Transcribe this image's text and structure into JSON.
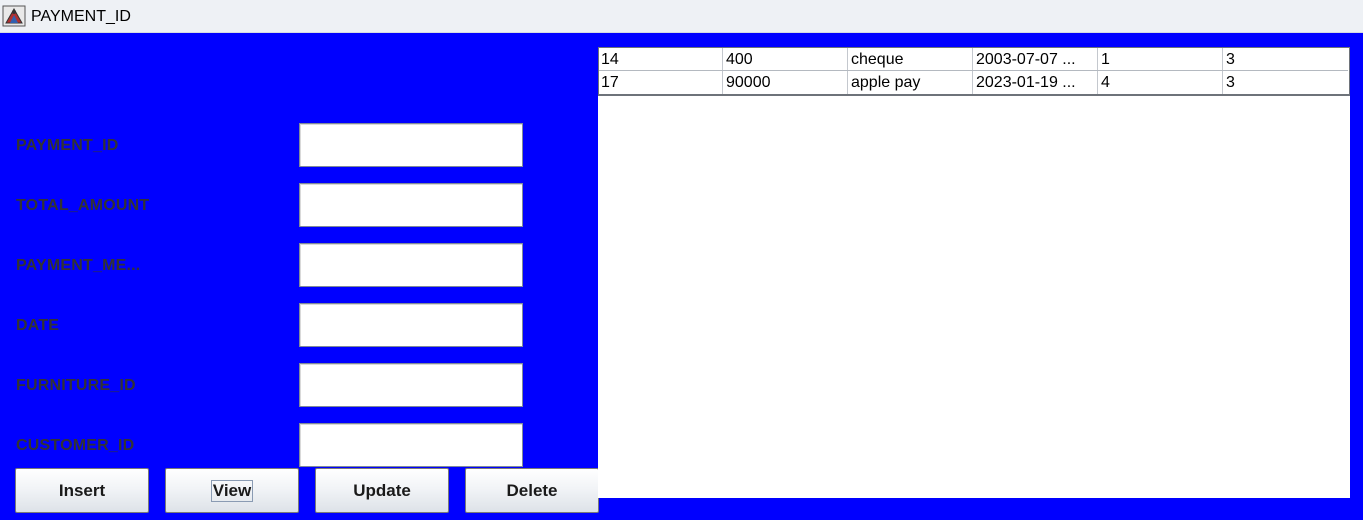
{
  "window": {
    "title": "PAYMENT_ID",
    "app_icon": "java-app-icon"
  },
  "form": {
    "fields": [
      {
        "label": "PAYMENT_ID",
        "value": ""
      },
      {
        "label": "TOTAL_AMOUNT",
        "value": ""
      },
      {
        "label": "PAYMENT_ME...",
        "value": ""
      },
      {
        "label": "DATE",
        "value": ""
      },
      {
        "label": "FURNITURE_ID",
        "value": ""
      },
      {
        "label": "CUSTOMER_ID",
        "value": ""
      }
    ]
  },
  "buttons": {
    "insert": "Insert",
    "view": "View",
    "update": "Update",
    "delete": "Delete"
  },
  "table": {
    "rows": [
      [
        "14",
        "400",
        "cheque",
        "2003-07-07 ...",
        "1",
        "3"
      ],
      [
        "17",
        "90000",
        "apple pay",
        "2023-01-19 ...",
        "4",
        "3"
      ]
    ]
  },
  "colors": {
    "panel_background": "#0000ff",
    "label_text": "#333333"
  }
}
